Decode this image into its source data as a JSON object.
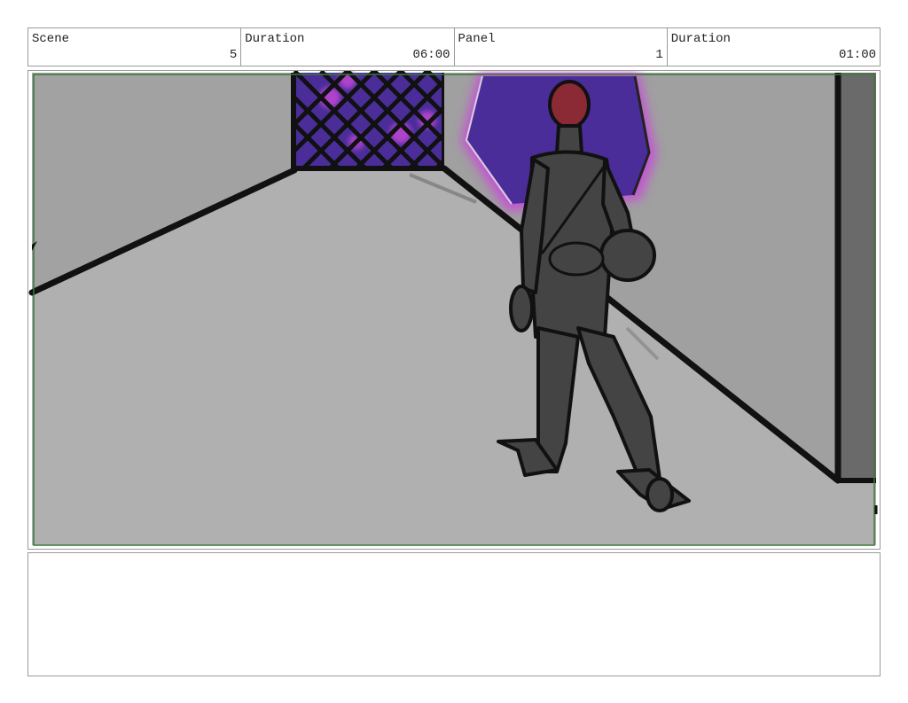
{
  "header": {
    "scene_label": "Scene",
    "scene_value": "5",
    "scene_duration_label": "Duration",
    "scene_duration_value": "06:00",
    "panel_label": "Panel",
    "panel_value": "1",
    "panel_duration_label": "Duration",
    "panel_duration_value": "01:00"
  },
  "frame": {
    "safe_area_color": "#3a7a3a",
    "floor_color": "#b0b0b0",
    "left_wall_color": "#a2a2a2",
    "right_wall_color": "#a0a0a0",
    "pillar_color": "#6a6a6a",
    "portal_color": "#4b2d9a",
    "portal_glow_color": "#c84ad8",
    "figure_color": "#444444",
    "head_color": "#8b2a35"
  },
  "notes": {
    "text": ""
  }
}
